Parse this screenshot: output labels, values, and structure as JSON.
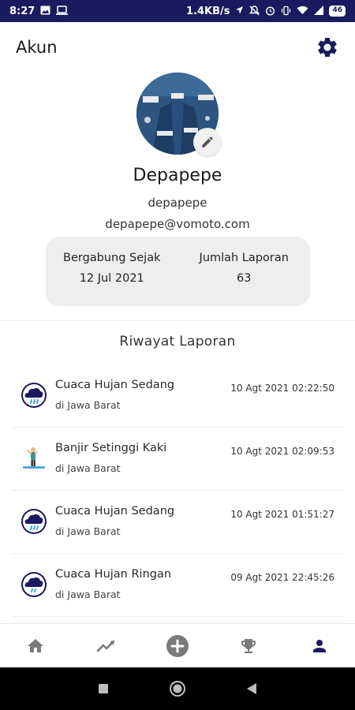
{
  "status_bar": {
    "time": "8:27",
    "network_speed": "1.4KB/s",
    "battery": "46",
    "icons": [
      "image-icon",
      "laptop-icon",
      "location-icon",
      "mute-icon",
      "alarm-icon",
      "vibrate-icon",
      "wifi-icon",
      "signal-icon",
      "battery-icon"
    ]
  },
  "app_bar": {
    "title": "Akun",
    "settings_icon": "gear-icon"
  },
  "profile": {
    "name": "Depapepe",
    "username": "depapepe",
    "email": "depapepe@vomoto.com",
    "edit_icon": "pencil-icon"
  },
  "stats": {
    "joined_label": "Bergabung Sejak",
    "joined_value": "12 Jul 2021",
    "reports_label": "Jumlah Laporan",
    "reports_value": "63"
  },
  "history": {
    "title": "Riwayat Laporan",
    "items": [
      {
        "title": "Cuaca Hujan Sedang",
        "location": "di Jawa Barat",
        "time": "10 Agt 2021 02:22:50",
        "icon": "rain-cloud-icon"
      },
      {
        "title": "Banjir Setinggi Kaki",
        "location": "di Jawa Barat",
        "time": "10 Agt 2021 02:09:53",
        "icon": "flood-person-icon"
      },
      {
        "title": "Cuaca Hujan Sedang",
        "location": "di Jawa Barat",
        "time": "10 Agt 2021 01:51:27",
        "icon": "rain-cloud-icon"
      },
      {
        "title": "Cuaca Hujan Ringan",
        "location": "di Jawa Barat",
        "time": "09 Agt 2021 22:45:26",
        "icon": "rain-cloud-icon"
      }
    ]
  },
  "bottom_nav": {
    "items": [
      "home-icon",
      "trend-icon",
      "add-icon",
      "trophy-icon",
      "person-icon"
    ],
    "active": "person-icon"
  },
  "colors": {
    "primary": "#1c1a5e",
    "card_bg": "#eeeeee",
    "nav_inactive": "#7a7a7a"
  }
}
